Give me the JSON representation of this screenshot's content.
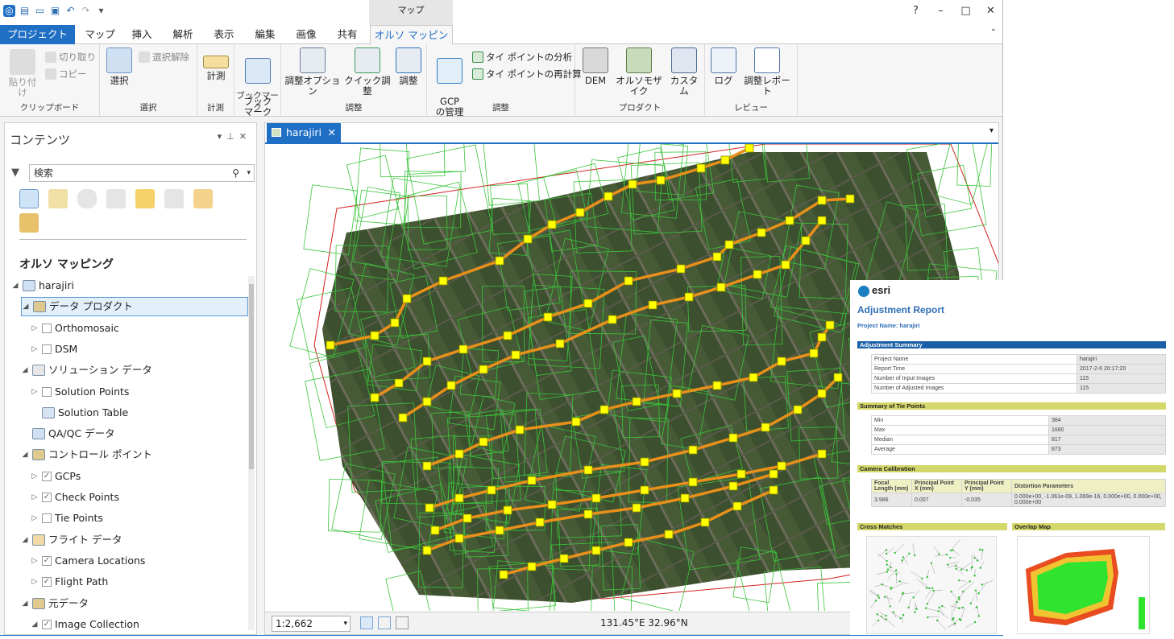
{
  "window": {
    "context_tab": "マップ",
    "help": "?",
    "minimize": "–",
    "maximize": "□",
    "close": "✕"
  },
  "tabs": [
    "プロジェクト",
    "マップ",
    "挿入",
    "解析",
    "表示",
    "編集",
    "画像",
    "共有",
    "オルソ マッピング"
  ],
  "ribbon": {
    "clipboard": {
      "paste": "貼り付け",
      "cut": "切り取り",
      "copy": "コピー",
      "label": "クリップボード"
    },
    "selection": {
      "select": "選択",
      "clear": "選択解除",
      "label": "選択"
    },
    "measure": {
      "measure": "計測",
      "label": "計測"
    },
    "bookmark": {
      "btn": "ブック\nマーク",
      "label": "ブックマーク"
    },
    "adjust1": {
      "options": "調整オプション",
      "quick": "クイック調整",
      "adjust": "調整",
      "label": "調整"
    },
    "adjust2": {
      "gcp": "GCP\nの管理",
      "analyze": "タイ ポイントの分析",
      "recompute": "タイ ポイントの再計算",
      "label": "調整"
    },
    "product": {
      "dem": "DEM",
      "mosaic": "オルソモザイク",
      "custom": "カスタム",
      "label": "プロダクト"
    },
    "review": {
      "log": "ログ",
      "report": "調整レポート",
      "label": "レビュー"
    }
  },
  "contents": {
    "title": "コンテンツ",
    "search_placeholder": "検索",
    "section": "オルソ マッピング",
    "tree": [
      {
        "label": "harajiri",
        "level": 0,
        "toggle": "◢"
      },
      {
        "label": "データ プロダクト",
        "level": 1,
        "toggle": "◢",
        "selected": true
      },
      {
        "label": "Orthomosaic",
        "level": 2,
        "toggle": "▷",
        "check": ""
      },
      {
        "label": "DSM",
        "level": 2,
        "toggle": "▷",
        "check": ""
      },
      {
        "label": "ソリューション データ",
        "level": 1,
        "toggle": "◢"
      },
      {
        "label": "Solution Points",
        "level": 2,
        "toggle": "▷",
        "check": ""
      },
      {
        "label": "Solution Table",
        "level": 2,
        "toggle": ""
      },
      {
        "label": "QA/QC データ",
        "level": 1,
        "toggle": ""
      },
      {
        "label": "コントロール ポイント",
        "level": 1,
        "toggle": "◢"
      },
      {
        "label": "GCPs",
        "level": 2,
        "toggle": "▷",
        "check": "✓"
      },
      {
        "label": "Check Points",
        "level": 2,
        "toggle": "▷",
        "check": "✓"
      },
      {
        "label": "Tie Points",
        "level": 2,
        "toggle": "▷",
        "check": ""
      },
      {
        "label": "フライト データ",
        "level": 1,
        "toggle": "◢"
      },
      {
        "label": "Camera Locations",
        "level": 2,
        "toggle": "▷",
        "check": "✓"
      },
      {
        "label": "Flight Path",
        "level": 2,
        "toggle": "▷",
        "check": "✓"
      },
      {
        "label": "元データ",
        "level": 1,
        "toggle": "◢"
      },
      {
        "label": "Image Collection",
        "level": 2,
        "toggle": "◢",
        "check": "✓"
      }
    ]
  },
  "map": {
    "tab": "harajiri",
    "tab_close": "✕",
    "scale": "1:2,662",
    "coords": "131.45°E 32.96°N"
  },
  "report": {
    "logo": "esri",
    "title": "Adjustment Report",
    "project": "Project Name: harajiri",
    "summary_title": "Adjustment Summary",
    "summary": [
      [
        "Project Name",
        "harajiri"
      ],
      [
        "Report Time",
        "2017-2-6 20:17:20"
      ],
      [
        "Number of Input Images",
        "115"
      ],
      [
        "Number of Adjusted Images",
        "115"
      ]
    ],
    "tie_title": "Summary of Tie Points",
    "tie": [
      [
        "Min",
        "384"
      ],
      [
        "Max",
        "1680"
      ],
      [
        "Median",
        "817"
      ],
      [
        "Average",
        "873"
      ]
    ],
    "cam_title": "Camera Calibration",
    "cam_headers": [
      "Focal Length (mm)",
      "Principal Point X (mm)",
      "Principal Point Y (mm)",
      "Distortion Parameters"
    ],
    "cam_values": [
      "3.986",
      "0.007",
      "-0.035",
      "0.000e+00, -1.061e-09, 1.069e-16, 0.000e+00, 0.000e+00, 0.000e+00"
    ],
    "cross_title": "Cross Matches",
    "overlap_title": "Overlap Map"
  },
  "colors": {
    "accent": "#1f6fc5",
    "flight": "#e8901a",
    "footprint": "#3cc43c",
    "camera": "#ffff00",
    "boundary": "#d42020"
  }
}
